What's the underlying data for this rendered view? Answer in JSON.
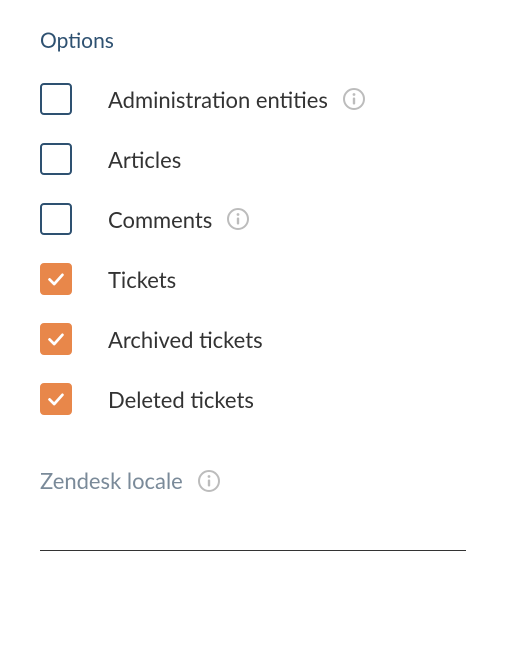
{
  "section": {
    "title": "Options"
  },
  "options": [
    {
      "label": "Administration entities",
      "checked": false,
      "has_info": true
    },
    {
      "label": "Articles",
      "checked": false,
      "has_info": false
    },
    {
      "label": "Comments",
      "checked": false,
      "has_info": true
    },
    {
      "label": "Tickets",
      "checked": true,
      "has_info": false
    },
    {
      "label": "Archived tickets",
      "checked": true,
      "has_info": false
    },
    {
      "label": "Deleted tickets",
      "checked": true,
      "has_info": false
    }
  ],
  "locale": {
    "label": "Zendesk locale",
    "has_info": true
  },
  "colors": {
    "title": "#2e5171",
    "checkbox_border": "#2e5171",
    "checkbox_checked": "#e8874a",
    "locale_text": "#7a8a99",
    "info_icon": "#bcbcbc"
  }
}
